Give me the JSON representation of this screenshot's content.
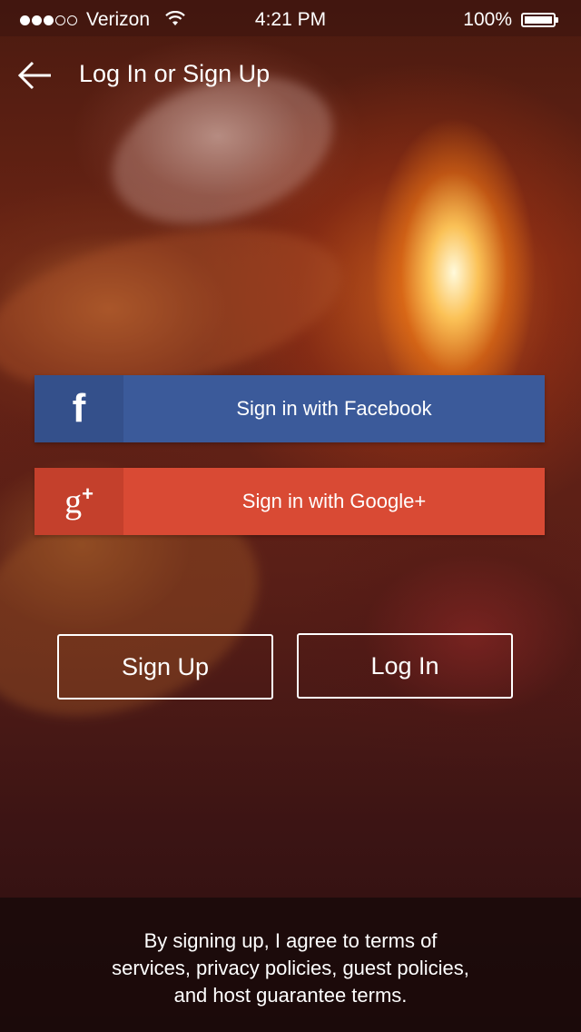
{
  "status_bar": {
    "carrier": "Verizon",
    "time": "4:21 PM",
    "battery": "100%",
    "signal_bars": 3,
    "signal_max": 5
  },
  "nav": {
    "back_icon": "arrow-left-icon",
    "title": "Log In or Sign Up"
  },
  "social": {
    "facebook": {
      "label": "Sign in with Facebook",
      "icon": "facebook-icon",
      "glyph": "f",
      "color": "#3b5a9a"
    },
    "google": {
      "label": "Sign in with Google+",
      "icon": "google-plus-icon",
      "glyph": "g",
      "glyph_plus": "+",
      "color": "#d94a34"
    }
  },
  "actions": {
    "signup_label": "Sign Up",
    "login_label": "Log In"
  },
  "footer": {
    "line1": "By signing up, I agree to  terms of",
    "line2": "services, privacy policies, guest policies,",
    "line3": "and host guarantee terms."
  }
}
